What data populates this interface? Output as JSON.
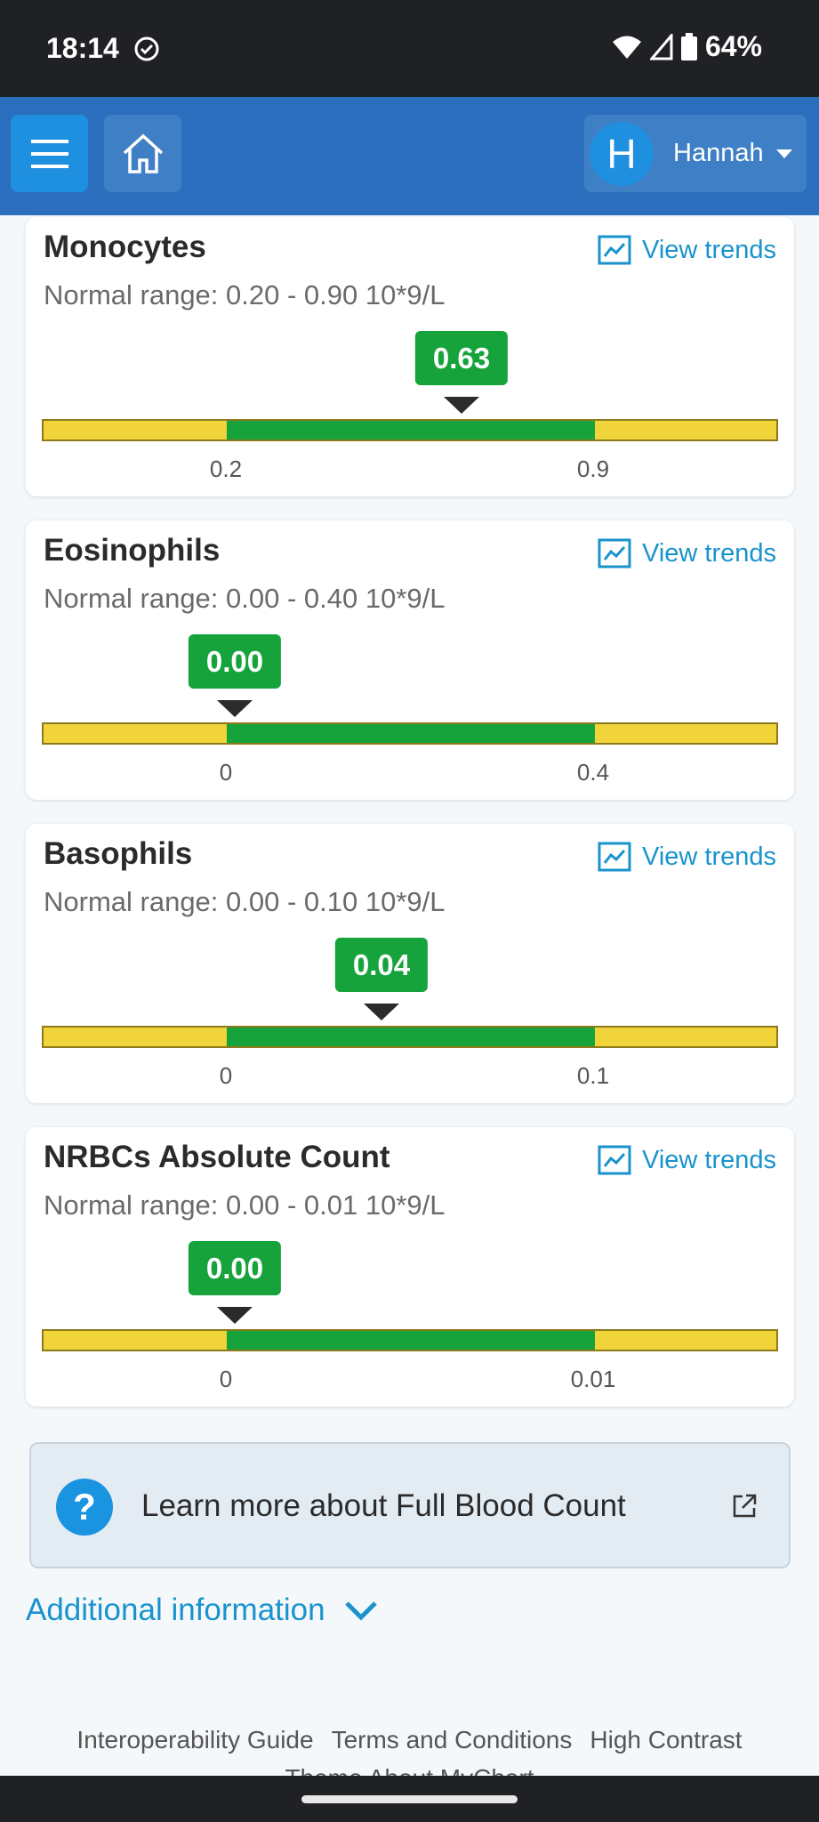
{
  "status_bar": {
    "time": "18:14",
    "battery": "64%"
  },
  "header": {
    "user_initial": "H",
    "user_name": "Hannah"
  },
  "results": [
    {
      "name": "Monocytes",
      "range": "Normal range: 0.20 - 0.90 10*9/L",
      "value": "0.63",
      "low_tick": "0.2",
      "high_tick": "0.9",
      "trends_label": "View trends"
    },
    {
      "name": "Eosinophils",
      "range": "Normal range: 0.00 - 0.40 10*9/L",
      "value": "0.00",
      "low_tick": "0",
      "high_tick": "0.4",
      "trends_label": "View trends"
    },
    {
      "name": "Basophils",
      "range": "Normal range: 0.00 - 0.10 10*9/L",
      "value": "0.04",
      "low_tick": "0",
      "high_tick": "0.1",
      "trends_label": "View trends"
    },
    {
      "name": "NRBCs Absolute Count",
      "range": "Normal range: 0.00 - 0.01 10*9/L",
      "value": "0.00",
      "low_tick": "0",
      "high_tick": "0.01",
      "trends_label": "View trends"
    }
  ],
  "learn_more": {
    "label": "Learn more about Full Blood Count"
  },
  "additional_info": {
    "label": "Additional information"
  },
  "footer": {
    "links": [
      "Interoperability Guide",
      "Terms and Conditions",
      "High Contrast"
    ],
    "line2": "Theme  About MyChart"
  },
  "colors": {
    "accent": "#2a6ebd",
    "normal": "#16a33b",
    "out_of_range": "#f0d43a",
    "link": "#1a93cc"
  }
}
